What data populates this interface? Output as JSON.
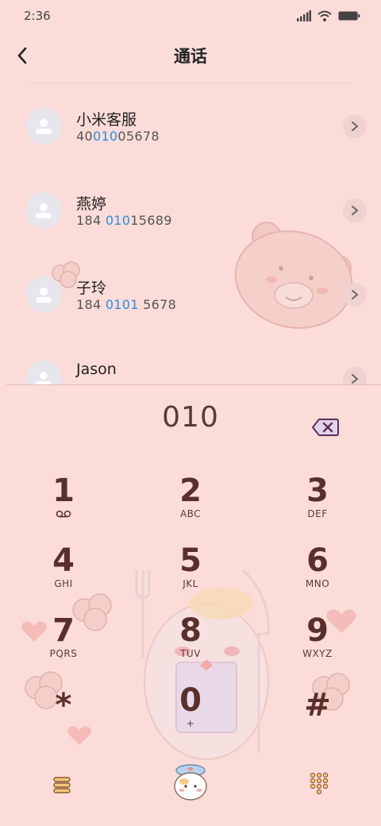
{
  "status_bar": {
    "time": "2:36"
  },
  "header": {
    "title": "通话"
  },
  "contacts": [
    {
      "name": "小米客服",
      "number_pre": "40",
      "number_hl": "010",
      "number_post": "05678"
    },
    {
      "name": "燕婷",
      "number_pre": "184 ",
      "number_hl": "010",
      "number_post": "15689"
    },
    {
      "name": "子玲",
      "number_pre": "184 ",
      "number_hl": "0101",
      "number_post": " 5678"
    },
    {
      "name": "Jason",
      "number_pre": "",
      "number_hl": "",
      "number_post": ""
    }
  ],
  "dialer": {
    "input": "010",
    "keys": [
      {
        "digit": "1",
        "letters": ""
      },
      {
        "digit": "2",
        "letters": "ABC"
      },
      {
        "digit": "3",
        "letters": "DEF"
      },
      {
        "digit": "4",
        "letters": "GHI"
      },
      {
        "digit": "5",
        "letters": "JKL"
      },
      {
        "digit": "6",
        "letters": "MNO"
      },
      {
        "digit": "7",
        "letters": "PQRS"
      },
      {
        "digit": "8",
        "letters": "TUV"
      },
      {
        "digit": "9",
        "letters": "WXYZ"
      },
      {
        "digit": "*",
        "letters": ""
      },
      {
        "digit": "0",
        "letters": "+"
      },
      {
        "digit": "#",
        "letters": ""
      }
    ]
  },
  "icons": {
    "back": "back-arrow-icon",
    "backspace": "backspace-icon",
    "menu": "menu-icon",
    "call": "call-icon",
    "keypad": "keypad-icon"
  }
}
